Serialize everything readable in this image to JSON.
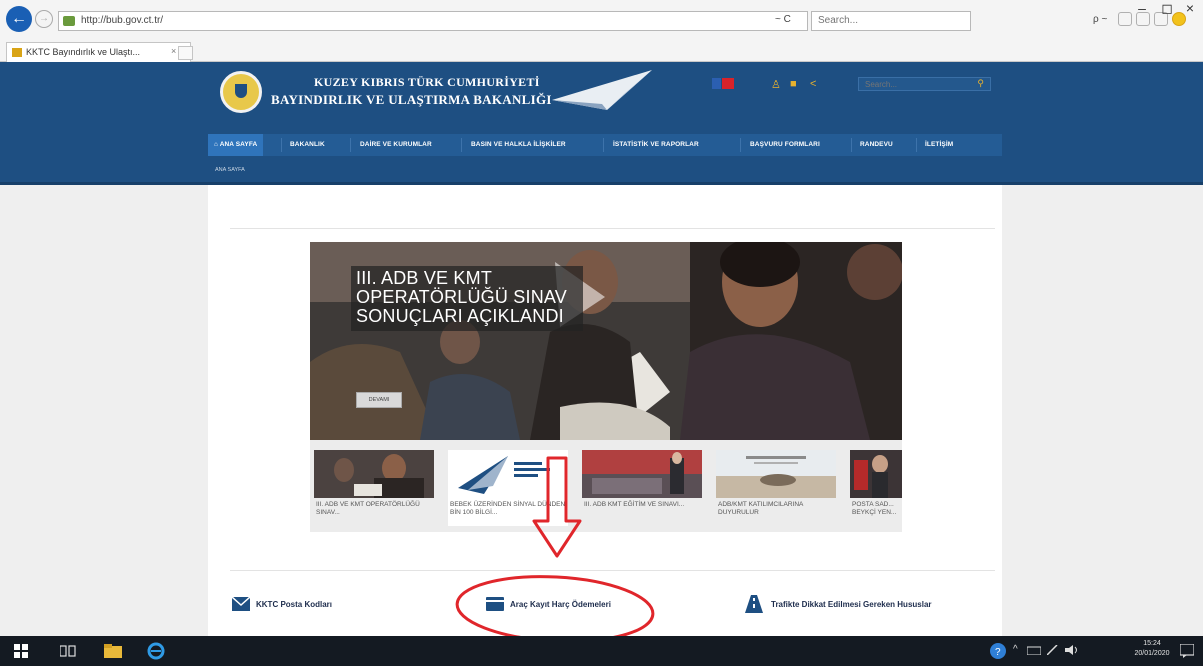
{
  "browser": {
    "url": "http://bub.gov.ct.tr/",
    "search_placeholder": "Search...",
    "tab_title": "KKTC Bayındırlık ve Ulaştı...",
    "tab_close": "×",
    "refresh": "~ C",
    "search_go": "ρ ~",
    "win_min": "–",
    "win_max": "◻",
    "win_close": "×"
  },
  "site": {
    "title_line1": "KUZEY KIBRIS TÜRK CUMHURİYETİ",
    "title_line2": "BAYINDIRLIK VE ULAŞTIRMA BAKANLIĞI",
    "search_placeholder": "Search...",
    "nav": [
      {
        "label": "ANA SAYFA"
      },
      {
        "label": "BAKANLIK"
      },
      {
        "label": "DAİRE VE KURUMLAR"
      },
      {
        "label": "BASIN VE HALKLA İLİŞKİLER"
      },
      {
        "label": "İSTATİSTİK VE RAPORLAR"
      },
      {
        "label": "BAŞVURU FORMLARI"
      },
      {
        "label": "RANDEVU"
      },
      {
        "label": "İLETİŞİM"
      }
    ],
    "breadcrumb": "ANA SAYFA"
  },
  "slider": {
    "caption_lines": [
      "III. ADB VE KMT",
      "OPERATÖRLÜĞÜ SINAV",
      "SONUÇLARI AÇIKLANDI"
    ],
    "button": "DEVAMI"
  },
  "thumbs": [
    {
      "caption": "III. ADB VE KMT OPERATÖRLÜĞÜ SINAV..."
    },
    {
      "caption": "BEBEK ÜZERİNDEN SİNYAL DÜNDEN BİN 100 BİLGİ..."
    },
    {
      "caption": "III. ADB KMT EĞİTİM VE SINAVI..."
    },
    {
      "caption": "ADB/KMT KATILIMCILARINA DUYURULUR"
    },
    {
      "caption": "POSTA SAD... BEYKÇİ YEN..."
    }
  ],
  "quick_links": [
    {
      "label": "KKTC Posta Kodları"
    },
    {
      "label": "Araç Kayıt Harç Ödemeleri"
    },
    {
      "label": "Trafikte Dikkat Edilmesi Gereken Hususlar"
    }
  ],
  "taskbar": {
    "time": "15:24",
    "date": "20/01/2020"
  },
  "colors": {
    "header_bg": "#1e4f82",
    "nav_bg": "#245c95",
    "annotation_red": "#e0262b"
  }
}
